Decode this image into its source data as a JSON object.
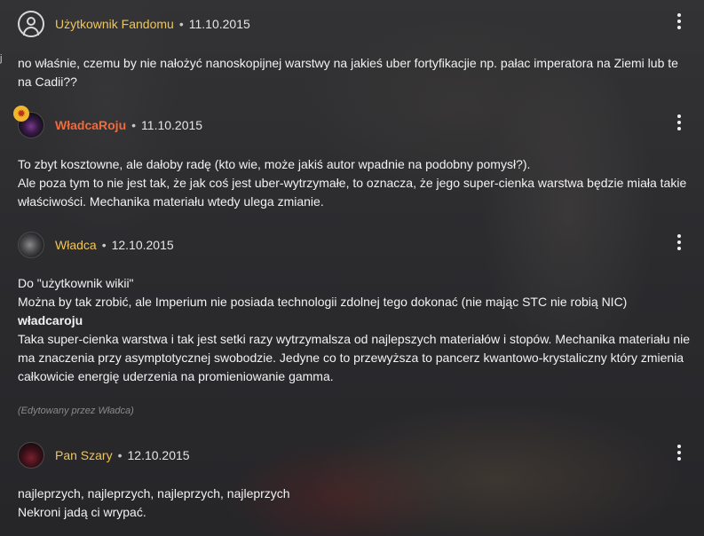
{
  "edge_mark": "j",
  "comments": [
    {
      "username": "Użytkownik Fandomu",
      "date": "11.10.2015",
      "avatar_icon": "default-user-icon",
      "body": [
        "no właśnie, czemu by nie nałożyć nanoskopijnej warstwy na jakieś uber fortyfikacjie np. pałac imperatora na Ziemi lub te na Cadii??"
      ]
    },
    {
      "username": "WładcaRoju",
      "date": "11.10.2015",
      "avatar_icon": "hive-tyrant-avatar",
      "badge_icon": "star-badge-icon",
      "badge_color": "#f0b62e",
      "username_color": "#f26a3a",
      "body": [
        "To zbyt kosztowne, ale dałoby radę (kto wie, może jakiś autor wpadnie na podobny pomysł?).",
        "Ale poza tym to nie jest tak, że jak coś jest uber-wytrzymałe, to oznacza, że jego super-cienka warstwa będzie miała takie właściwości. Mechanika materiału wtedy ulega zmianie."
      ]
    },
    {
      "username": "Władca",
      "date": "12.10.2015",
      "avatar_icon": "helmet-avatar",
      "body": [
        "Do \"użytkownik wikii\"",
        "Można by tak zrobić, ale Imperium nie posiada technologii zdolnej tego dokonać (nie mając STC nie robią NIC)",
        "władcaroju",
        "Taka super-cienka warstwa i tak jest setki razy wytrzymalsza od najlepszych materiałów i stopów. Mechanika materiału nie ma znaczenia przy asymptotycznej swobodzie. Jedyne co to przewyższa to pancerz kwantowo-krystaliczny który zmienia całkowicie energię uderzenia na promieniowanie gamma."
      ],
      "edited_note": "(Edytowany przez Władca)"
    },
    {
      "username": "Pan Szary",
      "date": "12.10.2015",
      "avatar_icon": "red-creature-avatar",
      "body": [
        "najleprzych, najleprzych, najleprzych, najleprzych",
        "Nekroni jadą ci wrypać."
      ]
    }
  ],
  "separator": "•",
  "more_icon": "more-vertical-icon",
  "colors": {
    "username": "#f0c659",
    "username_highlight": "#f26a3a",
    "text": "#f2f2f2",
    "edited": "#8a8a8a"
  }
}
